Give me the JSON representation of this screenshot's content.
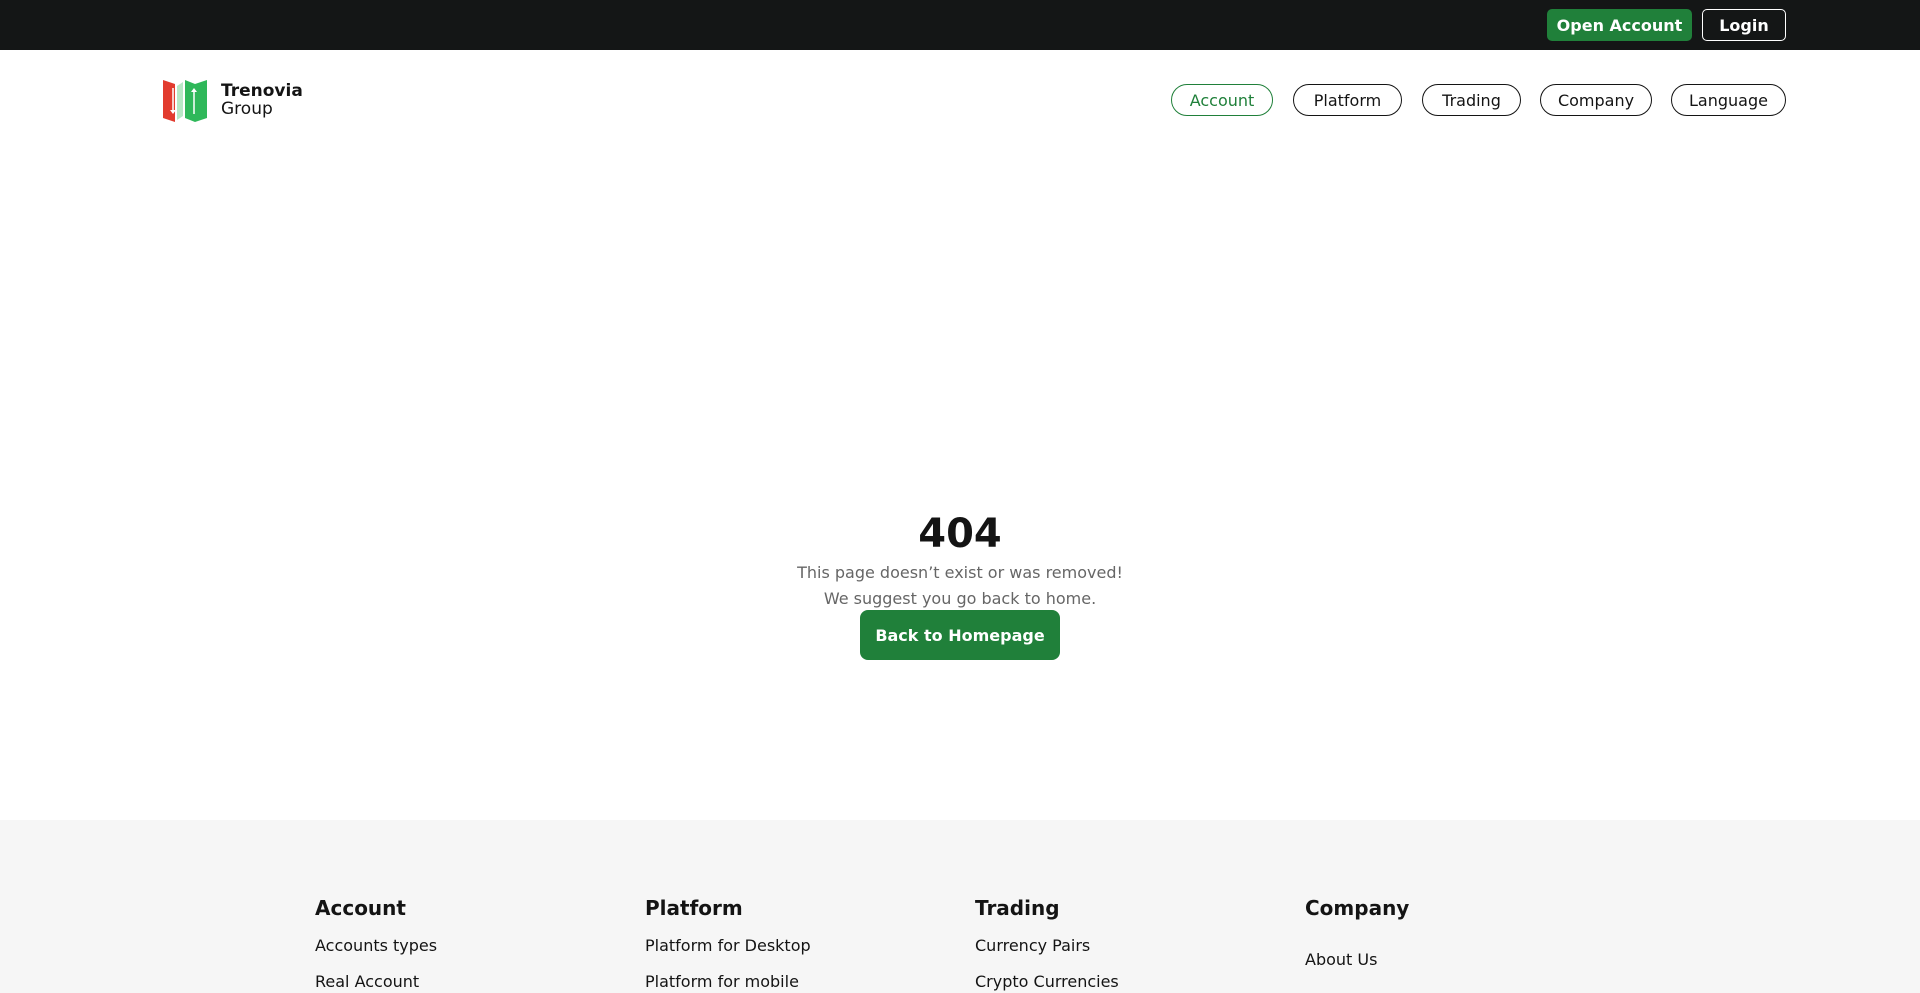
{
  "topbar": {
    "open_account": "Open Account",
    "login": "Login"
  },
  "brand": {
    "name": "Trenovia",
    "sub": "Group",
    "colors": {
      "red": "#e23b2e",
      "green": "#2fb85a"
    }
  },
  "nav": {
    "items": [
      {
        "label": "Account",
        "active": true
      },
      {
        "label": "Platform"
      },
      {
        "label": "Trading"
      },
      {
        "label": "Company"
      },
      {
        "label": "Language"
      }
    ]
  },
  "notfound": {
    "code": "404",
    "line1": "This page doesn’t exist or was removed!",
    "line2": "We suggest you go back to home.",
    "button": "Back to Homepage"
  },
  "footer": {
    "columns": [
      {
        "title": "Account",
        "links": [
          "Accounts types",
          "Real Account"
        ]
      },
      {
        "title": "Platform",
        "links": [
          "Platform for Desktop",
          "Platform for mobile"
        ]
      },
      {
        "title": "Trading",
        "links": [
          "Currency Pairs",
          "Crypto Currencies"
        ]
      },
      {
        "title": "Company",
        "links": [
          "About Us"
        ]
      }
    ]
  },
  "colors": {
    "accent": "#20803a",
    "topbar_bg": "#141616",
    "footer_bg": "#f6f6f6"
  }
}
